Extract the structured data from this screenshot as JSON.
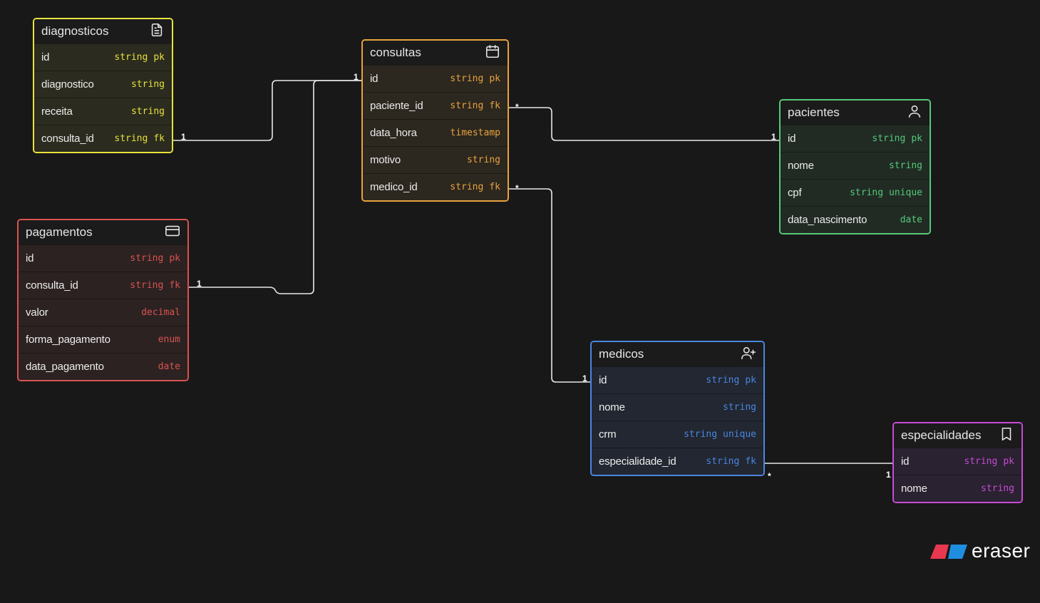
{
  "entities": {
    "diagnosticos": {
      "name": "diagnosticos",
      "color": "#e8e23c",
      "bg": "#2b2b1f",
      "fields": [
        {
          "name": "id",
          "type": "string",
          "key": "pk"
        },
        {
          "name": "diagnostico",
          "type": "string",
          "key": ""
        },
        {
          "name": "receita",
          "type": "string",
          "key": ""
        },
        {
          "name": "consulta_id",
          "type": "string",
          "key": "fk"
        }
      ]
    },
    "consultas": {
      "name": "consultas",
      "color": "#e9a33f",
      "bg": "#2c271f",
      "fields": [
        {
          "name": "id",
          "type": "string",
          "key": "pk"
        },
        {
          "name": "paciente_id",
          "type": "string",
          "key": "fk"
        },
        {
          "name": "data_hora",
          "type": "timestamp",
          "key": ""
        },
        {
          "name": "motivo",
          "type": "string",
          "key": ""
        },
        {
          "name": "medico_id",
          "type": "string",
          "key": "fk"
        }
      ]
    },
    "pacientes": {
      "name": "pacientes",
      "color": "#56c97a",
      "bg": "#212b24",
      "fields": [
        {
          "name": "id",
          "type": "string",
          "key": "pk"
        },
        {
          "name": "nome",
          "type": "string",
          "key": ""
        },
        {
          "name": "cpf",
          "type": "string",
          "key": "unique"
        },
        {
          "name": "data_nascimento",
          "type": "date",
          "key": ""
        }
      ]
    },
    "pagamentos": {
      "name": "pagamentos",
      "color": "#d9534f",
      "bg": "#2c2222",
      "fields": [
        {
          "name": "id",
          "type": "string",
          "key": "pk"
        },
        {
          "name": "consulta_id",
          "type": "string",
          "key": "fk"
        },
        {
          "name": "valor",
          "type": "decimal",
          "key": ""
        },
        {
          "name": "forma_pagamento",
          "type": "enum",
          "key": ""
        },
        {
          "name": "data_pagamento",
          "type": "date",
          "key": ""
        }
      ]
    },
    "medicos": {
      "name": "medicos",
      "color": "#4a86e0",
      "bg": "#222731",
      "fields": [
        {
          "name": "id",
          "type": "string",
          "key": "pk"
        },
        {
          "name": "nome",
          "type": "string",
          "key": ""
        },
        {
          "name": "crm",
          "type": "string",
          "key": "unique"
        },
        {
          "name": "especialidade_id",
          "type": "string",
          "key": "fk"
        }
      ]
    },
    "especialidades": {
      "name": "especialidades",
      "color": "#c74ad6",
      "bg": "#2a2230",
      "fields": [
        {
          "name": "id",
          "type": "string",
          "key": "pk"
        },
        {
          "name": "nome",
          "type": "string",
          "key": ""
        }
      ]
    }
  },
  "icons": {
    "diagnosticos": "document-icon",
    "consultas": "calendar-icon",
    "pacientes": "user-icon",
    "pagamentos": "credit-card-icon",
    "medicos": "user-plus-icon",
    "especialidades": "bookmark-icon"
  },
  "relationships": [
    {
      "from": "diagnosticos.consulta_id",
      "to": "consultas.id",
      "from_card": "1",
      "to_card": "1"
    },
    {
      "from": "pagamentos.consulta_id",
      "to": "consultas.id",
      "from_card": "1",
      "to_card": "1"
    },
    {
      "from": "consultas.paciente_id",
      "to": "pacientes.id",
      "from_card": "*",
      "to_card": "1"
    },
    {
      "from": "consultas.medico_id",
      "to": "medicos.id",
      "from_card": "*",
      "to_card": "1"
    },
    {
      "from": "medicos.especialidade_id",
      "to": "especialidades.id",
      "from_card": "*",
      "to_card": "1"
    }
  ],
  "brand": {
    "name": "eraser",
    "colors": [
      "#e8384f",
      "#1e8fe0"
    ]
  }
}
